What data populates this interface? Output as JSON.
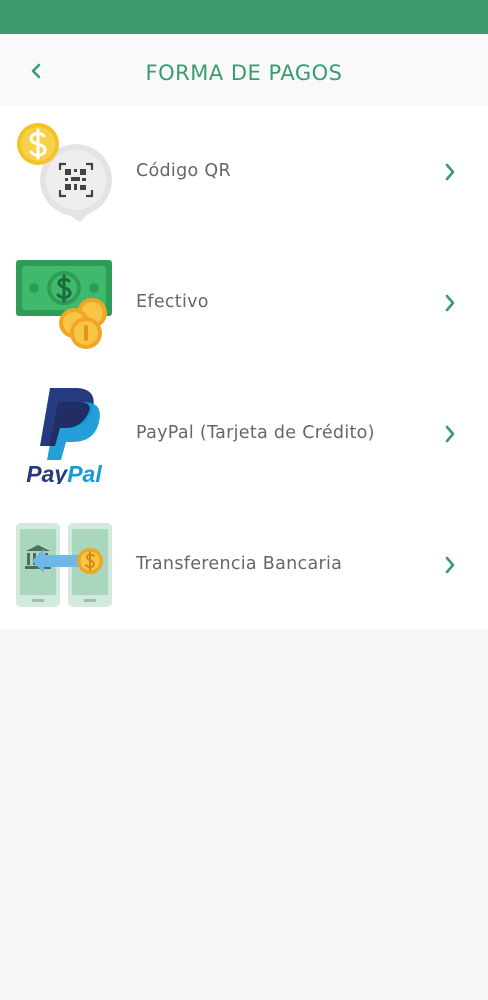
{
  "header": {
    "title": "FORMA DE PAGOS",
    "back_icon": "chevron-left-icon"
  },
  "payment_methods": [
    {
      "label": "Código QR",
      "icon": "qr-code-payment-icon"
    },
    {
      "label": "Efectivo",
      "icon": "cash-icon"
    },
    {
      "label": "PayPal (Tarjeta de Crédito)",
      "icon": "paypal-icon",
      "logo_text": "PayPal"
    },
    {
      "label": "Transferencia Bancaria",
      "icon": "bank-transfer-icon"
    }
  ],
  "colors": {
    "accent": "#3c9a6d",
    "title": "#3a9a72",
    "label": "#666666",
    "background": "#f6f6f8",
    "list_background": "#ffffff"
  }
}
